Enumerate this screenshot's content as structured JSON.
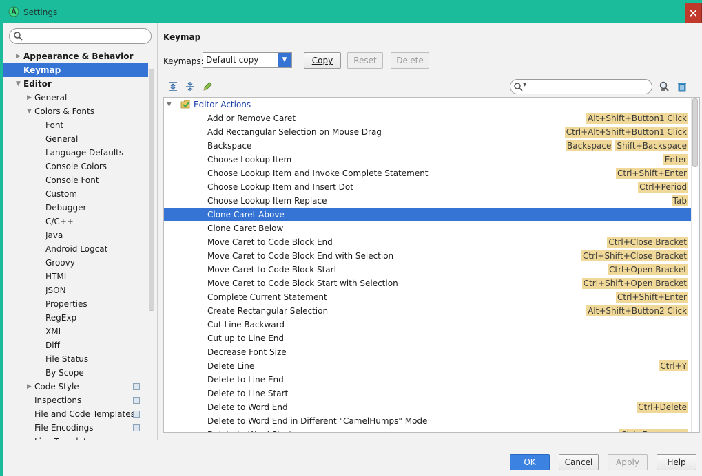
{
  "window": {
    "title": "Settings",
    "close_glyph": "✕"
  },
  "sidebar": {
    "search_value": "",
    "items": [
      {
        "label": "Appearance & Behavior",
        "level": 0,
        "arrow": "▶",
        "bold": true,
        "selected": false
      },
      {
        "label": "Keymap",
        "level": 0,
        "arrow": "",
        "bold": true,
        "selected": true
      },
      {
        "label": "Editor",
        "level": 0,
        "arrow": "▼",
        "bold": true,
        "selected": false
      },
      {
        "label": "General",
        "level": 1,
        "arrow": "▶",
        "bold": false,
        "selected": false
      },
      {
        "label": "Colors & Fonts",
        "level": 1,
        "arrow": "▼",
        "bold": false,
        "selected": false
      },
      {
        "label": "Font",
        "level": 2,
        "arrow": "",
        "bold": false,
        "selected": false
      },
      {
        "label": "General",
        "level": 2,
        "arrow": "",
        "bold": false,
        "selected": false
      },
      {
        "label": "Language Defaults",
        "level": 2,
        "arrow": "",
        "bold": false,
        "selected": false
      },
      {
        "label": "Console Colors",
        "level": 2,
        "arrow": "",
        "bold": false,
        "selected": false
      },
      {
        "label": "Console Font",
        "level": 2,
        "arrow": "",
        "bold": false,
        "selected": false
      },
      {
        "label": "Custom",
        "level": 2,
        "arrow": "",
        "bold": false,
        "selected": false
      },
      {
        "label": "Debugger",
        "level": 2,
        "arrow": "",
        "bold": false,
        "selected": false
      },
      {
        "label": "C/C++",
        "level": 2,
        "arrow": "",
        "bold": false,
        "selected": false
      },
      {
        "label": "Java",
        "level": 2,
        "arrow": "",
        "bold": false,
        "selected": false
      },
      {
        "label": "Android Logcat",
        "level": 2,
        "arrow": "",
        "bold": false,
        "selected": false
      },
      {
        "label": "Groovy",
        "level": 2,
        "arrow": "",
        "bold": false,
        "selected": false
      },
      {
        "label": "HTML",
        "level": 2,
        "arrow": "",
        "bold": false,
        "selected": false
      },
      {
        "label": "JSON",
        "level": 2,
        "arrow": "",
        "bold": false,
        "selected": false
      },
      {
        "label": "Properties",
        "level": 2,
        "arrow": "",
        "bold": false,
        "selected": false
      },
      {
        "label": "RegExp",
        "level": 2,
        "arrow": "",
        "bold": false,
        "selected": false
      },
      {
        "label": "XML",
        "level": 2,
        "arrow": "",
        "bold": false,
        "selected": false
      },
      {
        "label": "Diff",
        "level": 2,
        "arrow": "",
        "bold": false,
        "selected": false
      },
      {
        "label": "File Status",
        "level": 2,
        "arrow": "",
        "bold": false,
        "selected": false
      },
      {
        "label": "By Scope",
        "level": 2,
        "arrow": "",
        "bold": false,
        "selected": false
      },
      {
        "label": "Code Style",
        "level": 1,
        "arrow": "▶",
        "bold": false,
        "selected": false,
        "project_icon": true
      },
      {
        "label": "Inspections",
        "level": 1,
        "arrow": "",
        "bold": false,
        "selected": false,
        "project_icon": true
      },
      {
        "label": "File and Code Templates",
        "level": 1,
        "arrow": "",
        "bold": false,
        "selected": false,
        "project_icon": true
      },
      {
        "label": "File Encodings",
        "level": 1,
        "arrow": "",
        "bold": false,
        "selected": false,
        "project_icon": true
      },
      {
        "label": "Live Templates",
        "level": 1,
        "arrow": "",
        "bold": false,
        "selected": false
      }
    ]
  },
  "main": {
    "title": "Keymap",
    "keymaps_label": "Keymaps:",
    "keymap_selected": "Default copy",
    "buttons": {
      "copy": "Copy",
      "reset": "Reset",
      "delete": "Delete"
    },
    "toolbar_icons": [
      "expand-all-icon",
      "collapse-all-icon",
      "edit-icon",
      "find-shortcut-icon",
      "clear-icon"
    ],
    "filter_value": "",
    "group_label": "Editor Actions",
    "actions": [
      {
        "label": "Add or Remove Caret",
        "shortcuts": [
          "Alt+Shift+Button1 Click"
        ],
        "selected": false
      },
      {
        "label": "Add Rectangular Selection on Mouse Drag",
        "shortcuts": [
          "Ctrl+Alt+Shift+Button1 Click"
        ],
        "selected": false
      },
      {
        "label": "Backspace",
        "shortcuts": [
          "Backspace",
          "Shift+Backspace"
        ],
        "selected": false
      },
      {
        "label": "Choose Lookup Item",
        "shortcuts": [
          "Enter"
        ],
        "selected": false
      },
      {
        "label": "Choose Lookup Item and Invoke Complete Statement",
        "shortcuts": [
          "Ctrl+Shift+Enter"
        ],
        "selected": false
      },
      {
        "label": "Choose Lookup Item and Insert Dot",
        "shortcuts": [
          "Ctrl+Period"
        ],
        "selected": false
      },
      {
        "label": "Choose Lookup Item Replace",
        "shortcuts": [
          "Tab"
        ],
        "selected": false
      },
      {
        "label": "Clone Caret Above",
        "shortcuts": [],
        "selected": true
      },
      {
        "label": "Clone Caret Below",
        "shortcuts": [],
        "selected": false
      },
      {
        "label": "Move Caret to Code Block End",
        "shortcuts": [
          "Ctrl+Close Bracket"
        ],
        "selected": false
      },
      {
        "label": "Move Caret to Code Block End with Selection",
        "shortcuts": [
          "Ctrl+Shift+Close Bracket"
        ],
        "selected": false
      },
      {
        "label": "Move Caret to Code Block Start",
        "shortcuts": [
          "Ctrl+Open Bracket"
        ],
        "selected": false
      },
      {
        "label": "Move Caret to Code Block Start with Selection",
        "shortcuts": [
          "Ctrl+Shift+Open Bracket"
        ],
        "selected": false
      },
      {
        "label": "Complete Current Statement",
        "shortcuts": [
          "Ctrl+Shift+Enter"
        ],
        "selected": false
      },
      {
        "label": "Create Rectangular Selection",
        "shortcuts": [
          "Alt+Shift+Button2 Click"
        ],
        "selected": false
      },
      {
        "label": "Cut Line Backward",
        "shortcuts": [],
        "selected": false
      },
      {
        "label": "Cut up to Line End",
        "shortcuts": [],
        "selected": false
      },
      {
        "label": "Decrease Font Size",
        "shortcuts": [],
        "selected": false
      },
      {
        "label": "Delete Line",
        "shortcuts": [
          "Ctrl+Y"
        ],
        "selected": false
      },
      {
        "label": "Delete to Line End",
        "shortcuts": [],
        "selected": false
      },
      {
        "label": "Delete to Line Start",
        "shortcuts": [],
        "selected": false
      },
      {
        "label": "Delete to Word End",
        "shortcuts": [
          "Ctrl+Delete"
        ],
        "selected": false
      },
      {
        "label": "Delete to Word End in Different \"CamelHumps\" Mode",
        "shortcuts": [],
        "selected": false
      },
      {
        "label": "Delete to Word Start",
        "shortcuts": [
          "Ctrl+Backspace"
        ],
        "selected": false
      }
    ]
  },
  "footer": {
    "ok": "OK",
    "cancel": "Cancel",
    "apply": "Apply",
    "help": "Help"
  },
  "colors": {
    "accent": "#1abc9c",
    "selection": "#3574d4",
    "shortcut_bg": "#f0d898",
    "close": "#c0392b"
  }
}
